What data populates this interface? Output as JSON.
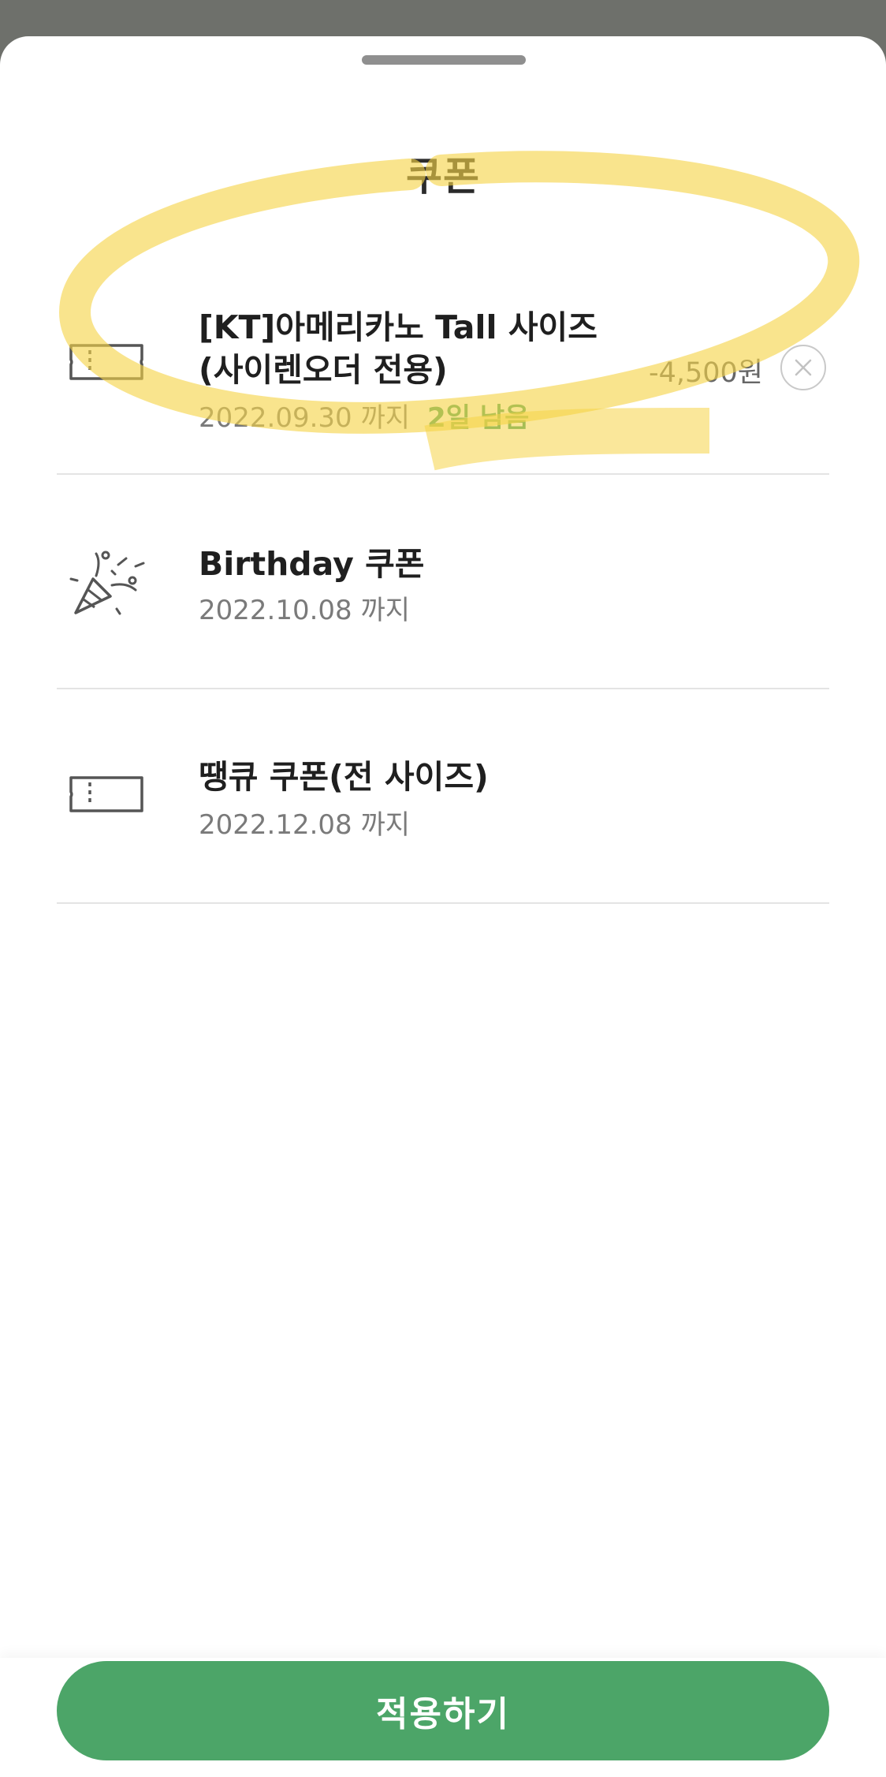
{
  "sheet": {
    "title": "쿠폰"
  },
  "coupons": [
    {
      "name_line1": "[KT]아메리카노 Tall 사이즈",
      "name_line2": "(사이렌오더 전용)",
      "expiry": "2022.09.30 까지",
      "days_left": "2일 남음",
      "discount": "-4,500원",
      "icon": "ticket-icon"
    },
    {
      "name": "Birthday 쿠폰",
      "expiry": "2022.10.08 까지",
      "icon": "party-popper-icon"
    },
    {
      "name": "땡큐 쿠폰(전 사이즈)",
      "expiry": "2022.12.08 까지",
      "icon": "ticket-icon"
    }
  ],
  "footer": {
    "apply_label": "적용하기"
  },
  "colors": {
    "accent_green": "#4ca568",
    "days_left_green": "#46a264",
    "highlighter_yellow": "#f6d447",
    "backdrop": "#6e706b"
  }
}
